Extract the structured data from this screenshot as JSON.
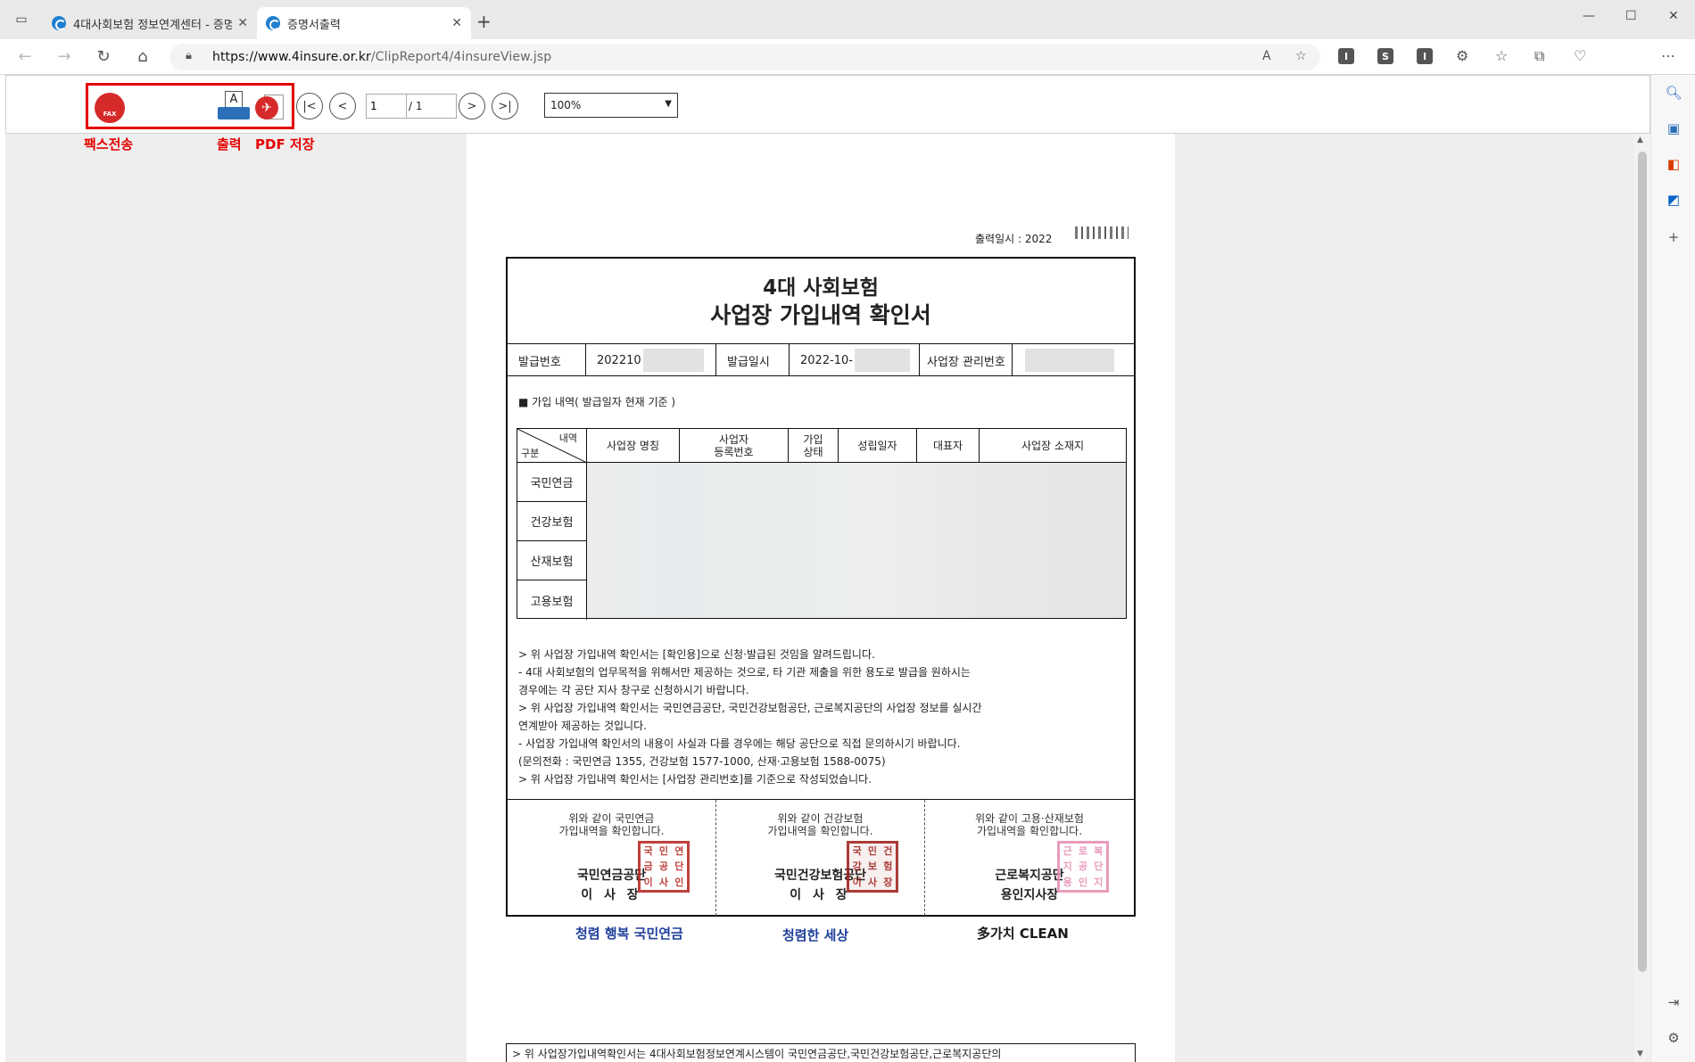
{
  "browser": {
    "tabs": [
      {
        "title": "4대사회보험 정보연계센터 - 증명",
        "active": false
      },
      {
        "title": "증명서출력",
        "active": true
      }
    ],
    "url_host": "https://www.4insure.or.kr",
    "url_path": "/ClipReport4/4insureView.jsp",
    "extensions": [
      "I",
      "S",
      "I"
    ]
  },
  "viewer": {
    "page_current": "1",
    "page_total": "/ 1",
    "zoom": "100%",
    "labels": {
      "fax": "팩스전송",
      "print": "출력",
      "pdf": "PDF 저장"
    }
  },
  "document": {
    "print_date": "출력일시 : 2022",
    "title_line1": "4대 사회보험",
    "title_line2": "사업장 가입내역 확인서",
    "issue_no_label": "발급번호",
    "issue_no_value": "202210",
    "issue_date_label": "발급일시",
    "issue_date_value": "2022-10-",
    "mgmt_no_label": "사업장 관리번호",
    "section_head": "■ 가입 내역( 발급일자 현재 기준 )",
    "diag_top": "내역",
    "diag_bottom": "구분",
    "columns": [
      "사업장 명칭",
      "사업자\n등록번호",
      "가입\n상태",
      "성립일자",
      "대표자",
      "사업장 소재지"
    ],
    "rows": [
      "국민연금",
      "건강보험",
      "산재보험",
      "고용보험"
    ],
    "notes": [
      "> 위 사업장 가입내역 확인서는 [확인용]으로 신청·발급된 것임을 알려드립니다.",
      "  - 4대 사회보험의 업무목적을 위해서만 제공하는 것으로, 타 기관 제출을 위한 용도로 발급을 원하시는",
      "    경우에는 각 공단 지사 창구로 신청하시기 바랍니다.",
      "> 위 사업장 가입내역 확인서는 국민연금공단, 국민건강보험공단, 근로복지공단의 사업장 정보를 실시간",
      "   연계받아 제공하는 것입니다.",
      "  - 사업장 가입내역 확인서의 내용이 사실과 다를 경우에는 해당 공단으로 직접 문의하시기 바랍니다.",
      "    (문의전화 : 국민연금 1355, 건강보험 1577-1000, 산재·고용보험 1588-0075)",
      "> 위 사업장 가입내역 확인서는 [사업장 관리번호]를 기준으로 작성되었습니다."
    ],
    "signs": [
      {
        "l1": "위와 같이 국민연금",
        "l2": "가입내역을 확인합니다.",
        "org": "국민연금공단",
        "role": "이 사 장",
        "seal_color": "#b3201c",
        "seal_chars": "국민연금공단이사장인"
      },
      {
        "l1": "위와 같이 건강보험",
        "l2": "가입내역을 확인합니다.",
        "org": "국민건강보험공단",
        "role": "이 사 장",
        "seal_color": "#9c1a14",
        "seal_chars": "국민건강보험공단이사장"
      },
      {
        "l1": "위와 같이 고용·산재보험",
        "l2": "가입내역을 확인합니다.",
        "org": "근로복지공단",
        "role": "용인지사장",
        "seal_color": "#e58ab0",
        "seal_chars": "근로복지공단용인지사"
      }
    ],
    "logos": [
      "청렴 행복 국민연금",
      "청렴한 세상",
      "多가치 CLEAN"
    ],
    "bottom_note": "> 위 사업장가입내역확인서는 4대사회보험정보연계시스템이 국민연금공단,국민건강보험공단,근로복지공단의"
  },
  "colors": {
    "highlight": "#e30000",
    "tab_bg": "#e9e9e9",
    "viewer_bg": "#eeeeee"
  }
}
